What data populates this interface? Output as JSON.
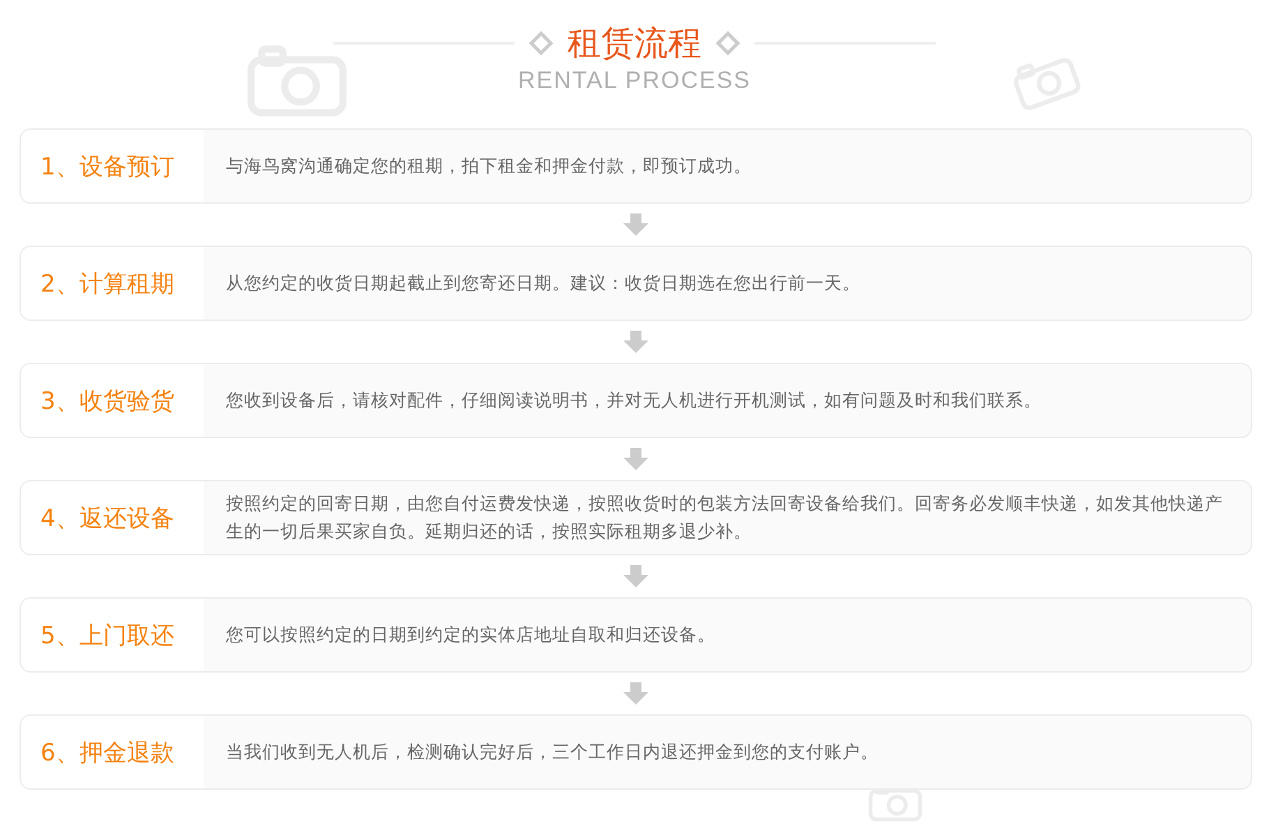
{
  "header": {
    "title": "租赁流程",
    "subtitle": "RENTAL PROCESS"
  },
  "steps": [
    {
      "label": "1、设备预订",
      "text": "与海鸟窝沟通确定您的租期，拍下租金和押金付款，即预订成功。"
    },
    {
      "label": "2、计算租期",
      "text": "从您约定的收货日期起截止到您寄还日期。建议：收货日期选在您出行前一天。"
    },
    {
      "label": "3、收货验货",
      "text": "您收到设备后，请核对配件，仔细阅读说明书，并对无人机进行开机测试，如有问题及时和我们联系。"
    },
    {
      "label": "4、返还设备",
      "text": "按照约定的回寄日期，由您自付运费发快递，按照收货时的包装方法回寄设备给我们。回寄务必发顺丰快递，如发其他快递产生的一切后果买家自负。延期归还的话，按照实际租期多退少补。"
    },
    {
      "label": "5、上门取还",
      "text": "您可以按照约定的日期到约定的实体店地址自取和归还设备。"
    },
    {
      "label": "6、押金退款",
      "text": "当我们收到无人机后，检测确认完好后，三个工作日内退还押金到您的支付账户。"
    }
  ]
}
